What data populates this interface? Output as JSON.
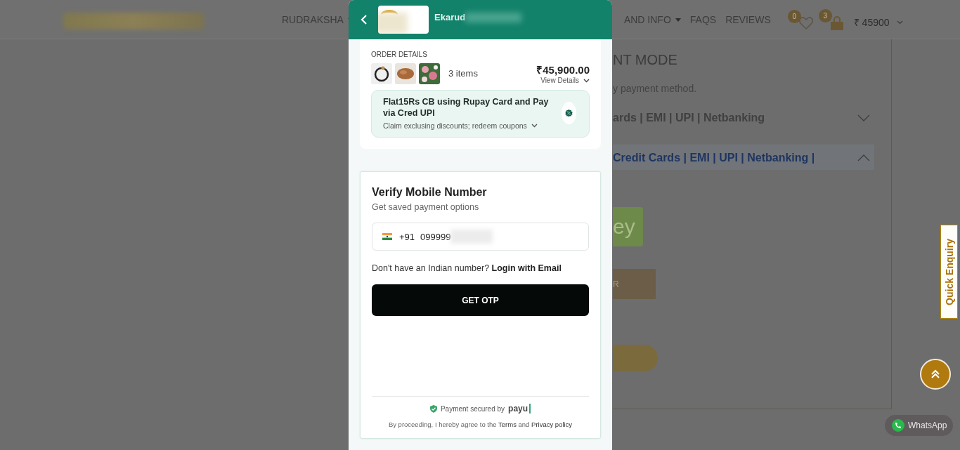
{
  "site_header": {
    "nav": [
      {
        "label": "RUDRAKSHA",
        "dropdown": true
      },
      {
        "label": "AND INFO",
        "dropdown": true
      },
      {
        "label": "FAQS",
        "dropdown": false
      },
      {
        "label": "REVIEWS",
        "dropdown": false
      }
    ],
    "wishlist_count": "0",
    "cart_count": "3",
    "cart_total": "₹ 45900"
  },
  "background_page": {
    "heading": "NT MODE",
    "subtitle": "y payment method.",
    "options": [
      {
        "label": "ards | EMI | UPI | Netbanking",
        "expanded": false
      },
      {
        "label": "Credit Cards | EMI | UPI | Netbanking |",
        "expanded": true
      }
    ],
    "wallet_button": "ey",
    "order_button": "R"
  },
  "checkout": {
    "merchant_name": "Ekarud",
    "order": {
      "heading": "ORDER DETAILS",
      "item_count": "3 items",
      "total": "₹45,900.00",
      "view_details": "View Details"
    },
    "offer": {
      "title": "Flat15Rs CB using Rupay Card and Pay via Cred UPI",
      "subtitle": "Claim exclusing discounts; redeem coupons"
    },
    "verify": {
      "title": "Verify Mobile Number",
      "subtitle": "Get saved payment options",
      "country_code": "+91",
      "phone": "099999",
      "alt_prompt": "Don't have an Indian number?",
      "alt_link": "Login with Email",
      "button": "GET OTP",
      "secured_by": "Payment secured by",
      "provider": "payu",
      "legal": {
        "before": "By proceeding, I hereby agree to the",
        "terms": "Terms",
        "joiner": "and",
        "privacy": "Privacy policy"
      }
    }
  },
  "floating": {
    "quick_enquiry": "Quick Enquiry",
    "whatsapp": "WhatsApp"
  }
}
